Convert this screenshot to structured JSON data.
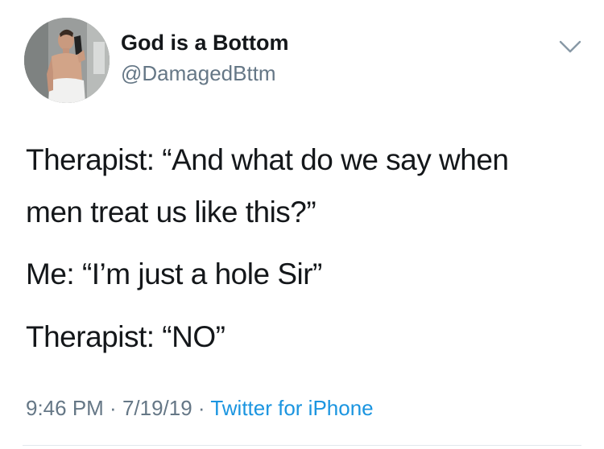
{
  "user": {
    "display_name": "God is a Bottom",
    "handle": "@DamagedBttm",
    "avatar": "profile-photo"
  },
  "icons": {
    "menu": "chevron-down-icon"
  },
  "tweet": {
    "lines": [
      "Therapist: “And what do we say when",
      "men treat us like this?”",
      "Me: “I’m just a hole Sir”",
      "Therapist: “NO”"
    ],
    "time": "9:46 PM",
    "date": "7/19/19",
    "separator": " · ",
    "source": "Twitter for iPhone"
  },
  "colors": {
    "text": "#14171a",
    "secondary": "#657786",
    "link": "#1b95e0",
    "divider": "#e1e8ed"
  }
}
